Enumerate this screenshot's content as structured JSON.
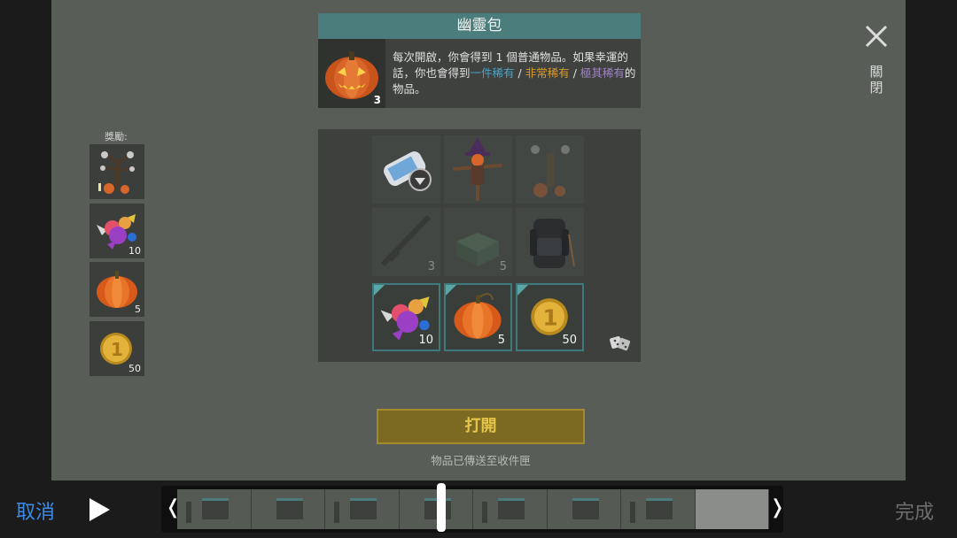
{
  "dialog": {
    "title": "幽靈包",
    "box_count": "3",
    "desc_part1": "每次開啟，你會得到 1 個普通物品。如果幸運的話，你也會得到",
    "rare1": "一件稀有",
    "sep1": " / ",
    "rare2": "非常稀有",
    "sep2": " / ",
    "rare3": "極其稀有",
    "desc_part2": "的物品。",
    "close_label": "關閉"
  },
  "rewards": {
    "label": "獎勵:",
    "items": [
      {
        "name": "spooky-tree-decoration",
        "count": ""
      },
      {
        "name": "candy",
        "count": "10"
      },
      {
        "name": "pumpkin",
        "count": "5"
      },
      {
        "name": "gold-coin",
        "count": "50"
      }
    ]
  },
  "grid": {
    "cells": [
      {
        "name": "blueprint-scroll",
        "count": ""
      },
      {
        "name": "scarecrow",
        "count": ""
      },
      {
        "name": "spooky-tree-decoration",
        "count": ""
      },
      {
        "name": "rifle",
        "count": "3"
      },
      {
        "name": "supply-crate",
        "count": "5"
      },
      {
        "name": "backpack",
        "count": ""
      },
      {
        "name": "candy",
        "count": "10"
      },
      {
        "name": "pumpkin",
        "count": "5"
      },
      {
        "name": "gold-coin",
        "count": "50"
      }
    ]
  },
  "open_button": "打開",
  "sent_note": "物品已傳送至收件匣",
  "editor": {
    "cancel": "取消",
    "done": "完成"
  },
  "colors": {
    "accent_teal": "#4a7d7b",
    "button_gold": "#e6c64a",
    "cancel_blue": "#3b8bea"
  }
}
